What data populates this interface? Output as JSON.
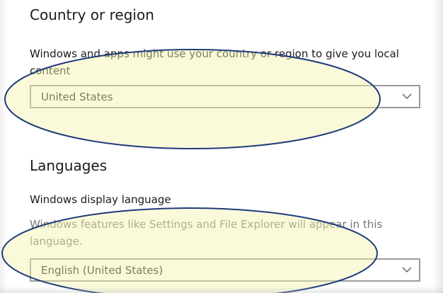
{
  "country_section": {
    "heading": "Country or region",
    "description": "Windows and apps might use your country or region to give you local content",
    "selected_value": "United States"
  },
  "languages_section": {
    "heading": "Languages",
    "display_language_label": "Windows display language",
    "display_language_description": "Windows features like Settings and File Explorer will appear in this language.",
    "selected_value": "English (United States)"
  },
  "icons": {
    "dropdown_chevron": "chevron-down-icon"
  },
  "colors": {
    "annotation_fill": "#f5f5c8",
    "annotation_stroke": "#1f3b7a",
    "dropdown_border": "#9a9a9a",
    "secondary_text": "#767676"
  }
}
